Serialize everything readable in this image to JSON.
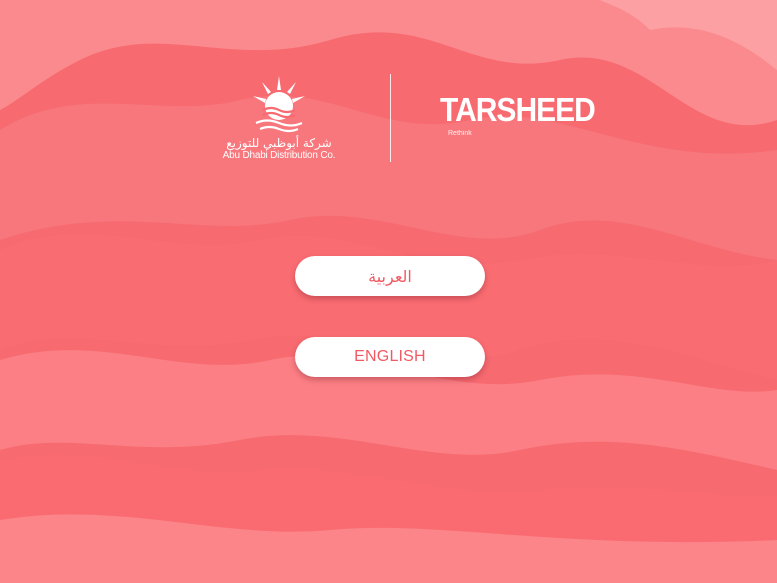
{
  "colors": {
    "background": "#f7646a",
    "button_bg": "#ffffff",
    "button_text": "#f25a63"
  },
  "logos": {
    "add": {
      "arabic_name": "شركة أبوظبي للتوزيع",
      "english_name": "Abu Dhabi Distribution Co.",
      "icon": "sun-over-waves-icon"
    },
    "tarsheed": {
      "wordmark": "TARSHEED",
      "tagline": "Rethink"
    }
  },
  "language_buttons": {
    "arabic_label": "العربية",
    "english_label": "ENGLISH"
  }
}
